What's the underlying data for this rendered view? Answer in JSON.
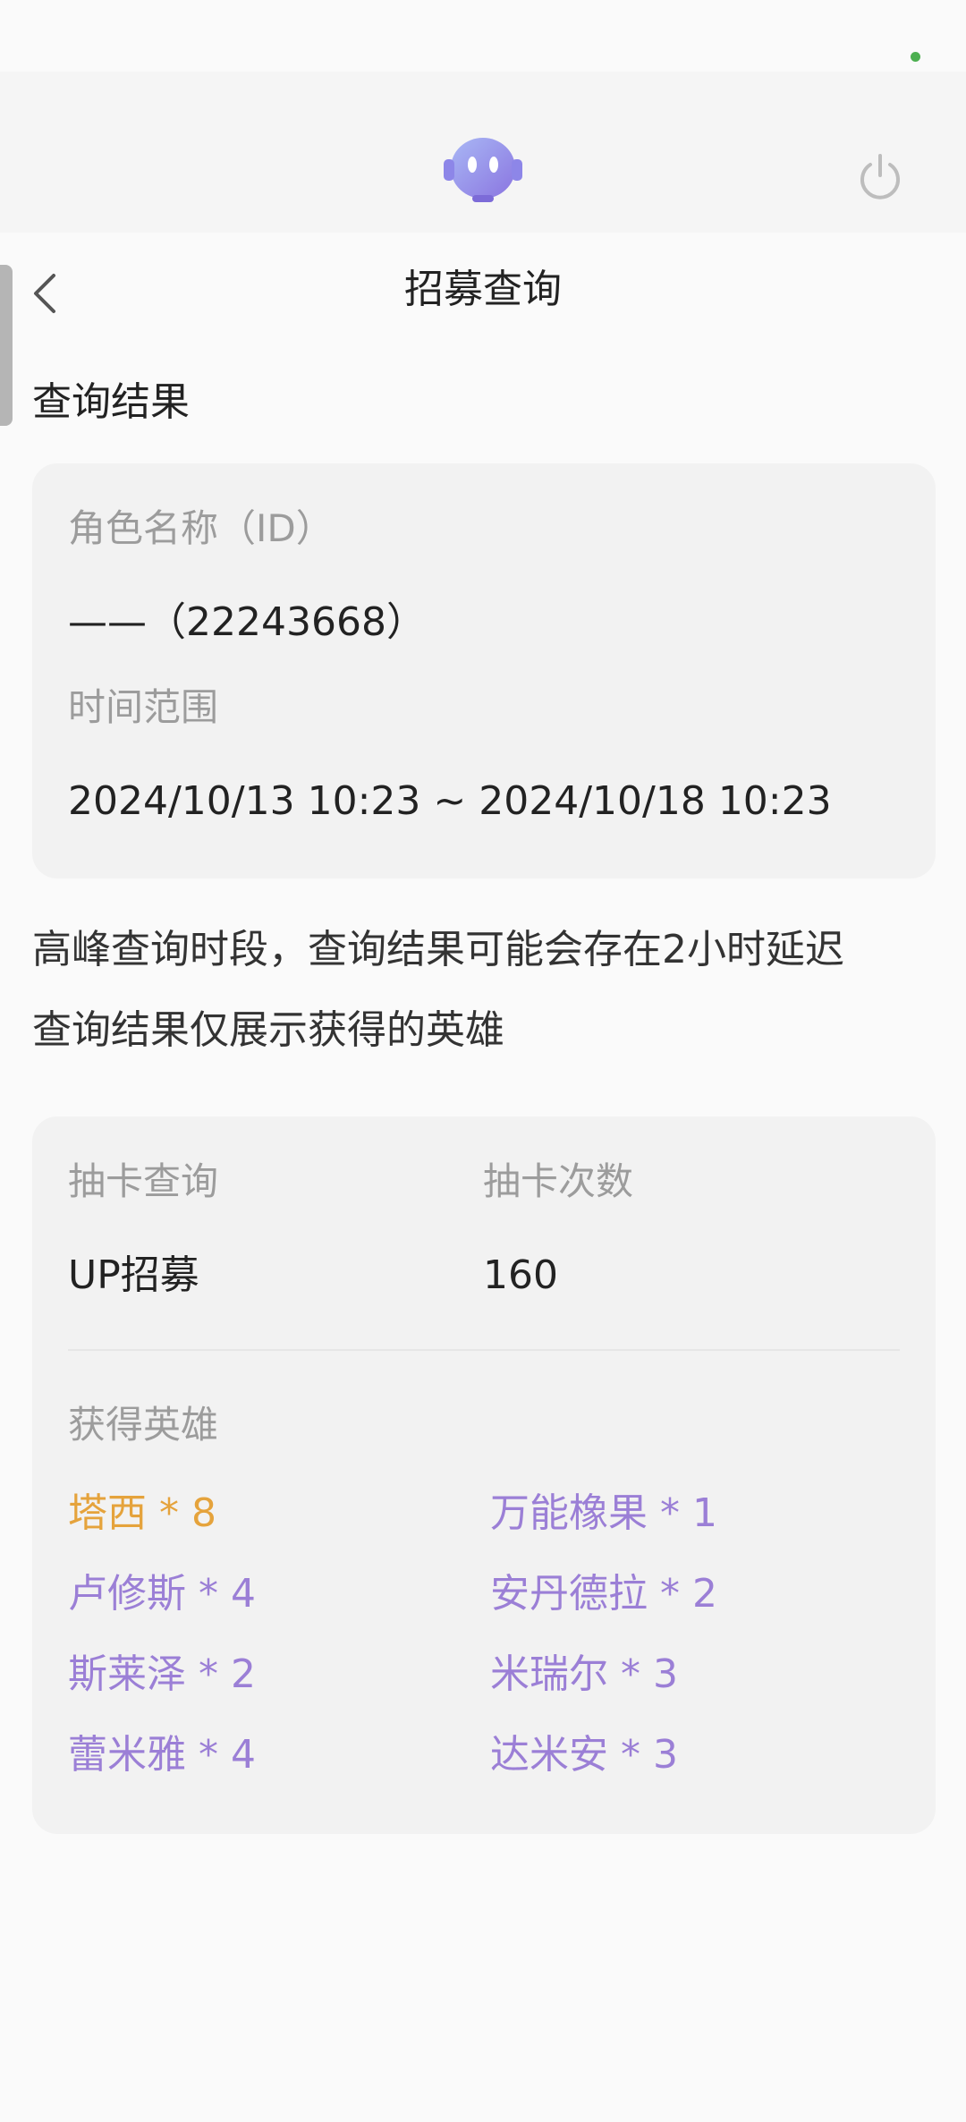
{
  "page_title": "招募查询",
  "section_title": "查询结果",
  "role": {
    "label": "角色名称（ID）",
    "value": "——（22243668）"
  },
  "time_range": {
    "label": "时间范围",
    "value": "2024/10/13 10:23 ~ 2024/10/18 10:23"
  },
  "notes": [
    "高峰查询时段，查询结果可能会存在2小时延迟",
    "查询结果仅展示获得的英雄"
  ],
  "draw": {
    "type_label": "抽卡查询",
    "count_label": "抽卡次数",
    "type_value": "UP招募",
    "count_value": "160",
    "heroes_label": "获得英雄",
    "heroes": [
      "塔西 * 8",
      "万能橡果 * 1",
      "卢修斯 * 4",
      "安丹德拉 * 2",
      "斯莱泽 * 2",
      "米瑞尔 * 3",
      "蕾米雅 * 4",
      "达米安 * 3"
    ]
  },
  "colors": {
    "highlight_hero": "#e5a33c",
    "normal_hero": "#9b7fd6",
    "status_dot": "#4caf50"
  },
  "icons": [
    "robot-assistant-icon",
    "power-icon",
    "back-arrow-icon"
  ]
}
